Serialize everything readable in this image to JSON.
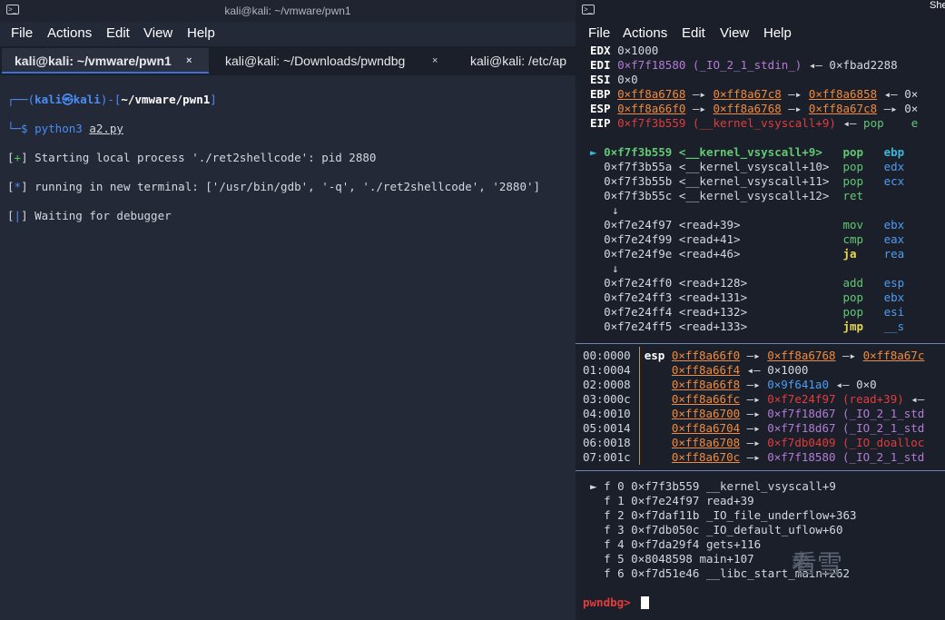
{
  "left_window": {
    "title": "kali@kali: ~/vmware/pwn1",
    "menu": [
      "File",
      "Actions",
      "Edit",
      "View",
      "Help"
    ],
    "tabs": [
      {
        "label": "kali@kali: ~/vmware/pwn1",
        "close": "×"
      },
      {
        "label": "kali@kali: ~/Downloads/pwndbg",
        "close": "×"
      },
      {
        "label": "kali@kali: /etc/ap",
        "close": ""
      }
    ],
    "prompt": {
      "open": "┌──(",
      "user": "kali㉿kali",
      "mid": ")-[",
      "path": "~/vmware/pwn1",
      "close": "]",
      "line2": "└─$ ",
      "cmd": "python3",
      "arg": "a2.py"
    },
    "output": [
      {
        "mark": "+",
        "text": "Starting local process './ret2shellcode': pid 2880"
      },
      {
        "mark": "*",
        "text": "running in new terminal: ['/usr/bin/gdb', '-q', './ret2shellcode', '2880']"
      },
      {
        "mark": "|",
        "text": "Waiting for debugger"
      }
    ]
  },
  "right_window": {
    "title": "She",
    "menu": [
      "File",
      "Actions",
      "Edit",
      "View",
      "Help"
    ],
    "registers": [
      {
        "name": "EDX",
        "parts": [
          [
            "dim",
            "0×1000"
          ]
        ]
      },
      {
        "name": "EDI",
        "parts": [
          [
            "mag",
            "0×f7f18580 (_IO_2_1_stdin_)"
          ],
          [
            "dim",
            " ◂— 0×fbad2288"
          ]
        ]
      },
      {
        "name": "ESI",
        "parts": [
          [
            "dim",
            "0×0"
          ]
        ]
      },
      {
        "name": "EBP",
        "parts": [
          [
            "orgul",
            "0×ff8a6768"
          ],
          [
            "dim",
            " —▸ "
          ],
          [
            "orgul",
            "0×ff8a67c8"
          ],
          [
            "dim",
            " —▸ "
          ],
          [
            "orgul",
            "0×ff8a6858"
          ],
          [
            "dim",
            " ◂— 0×"
          ]
        ]
      },
      {
        "name": "ESP",
        "parts": [
          [
            "orgul",
            "0×ff8a66f0"
          ],
          [
            "dim",
            " —▸ "
          ],
          [
            "orgul",
            "0×ff8a6768"
          ],
          [
            "dim",
            " —▸ "
          ],
          [
            "orgul",
            "0×ff8a67c8"
          ],
          [
            "dim",
            " —▸ 0×"
          ]
        ]
      },
      {
        "name": "EIP",
        "parts": [
          [
            "red",
            "0×f7f3b559 (__kernel_vsyscall+9)"
          ],
          [
            "dim",
            " ◂— "
          ],
          [
            "gr",
            "pop    e"
          ]
        ]
      }
    ],
    "disasm": [
      {
        "cur": true,
        "addr": "0×f7f3b559",
        "sym": "<__kernel_vsyscall+9>",
        "op": "pop",
        "arg": "ebp",
        "opc": "gr",
        "argc": "cyan"
      },
      {
        "addr": "0×f7f3b55a",
        "sym": "<__kernel_vsyscall+10>",
        "op": "pop",
        "arg": "edx",
        "opc": "gr",
        "argc": "bl2"
      },
      {
        "addr": "0×f7f3b55b",
        "sym": "<__kernel_vsyscall+11>",
        "op": "pop",
        "arg": "ecx",
        "opc": "gr",
        "argc": "bl2"
      },
      {
        "addr": "0×f7f3b55c",
        "sym": "<__kernel_vsyscall+12>",
        "op": "ret",
        "arg": "",
        "opc": "gr",
        "argc": "bl2"
      },
      {
        "arrow": "↓"
      },
      {
        "addr": "0×f7e24f97",
        "sym": "<read+39>",
        "op": "mov",
        "arg": "ebx",
        "opc": "gr",
        "argc": "bl2"
      },
      {
        "addr": "0×f7e24f99",
        "sym": "<read+41>",
        "op": "cmp",
        "arg": "eax",
        "opc": "gr",
        "argc": "bl2"
      },
      {
        "addr": "0×f7e24f9e",
        "sym": "<read+46>",
        "op": "ja",
        "arg": "rea",
        "opc": "yel",
        "argc": "bl2"
      },
      {
        "arrow": "↓"
      },
      {
        "addr": "0×f7e24ff0",
        "sym": "<read+128>",
        "op": "add",
        "arg": "esp",
        "opc": "gr",
        "argc": "bl2"
      },
      {
        "addr": "0×f7e24ff3",
        "sym": "<read+131>",
        "op": "pop",
        "arg": "ebx",
        "opc": "gr",
        "argc": "bl2"
      },
      {
        "addr": "0×f7e24ff4",
        "sym": "<read+132>",
        "op": "pop",
        "arg": "esi",
        "opc": "gr",
        "argc": "bl2"
      },
      {
        "addr": "0×f7e24ff5",
        "sym": "<read+133>",
        "op": "jmp",
        "arg": "__s",
        "opc": "yel",
        "argc": "bl2"
      }
    ],
    "stack": [
      {
        "idx": "00:0000",
        "reg": "esp",
        "parts": [
          [
            "orgul",
            "0×ff8a66f0"
          ],
          [
            "dim",
            " —▸ "
          ],
          [
            "orgul",
            "0×ff8a6768"
          ],
          [
            "dim",
            " —▸ "
          ],
          [
            "orgul",
            "0×ff8a67c"
          ]
        ]
      },
      {
        "idx": "01:0004",
        "reg": "",
        "parts": [
          [
            "orgul",
            "0×ff8a66f4"
          ],
          [
            "dim",
            " ◂— 0×1000"
          ]
        ]
      },
      {
        "idx": "02:0008",
        "reg": "",
        "parts": [
          [
            "orgul",
            "0×ff8a66f8"
          ],
          [
            "dim",
            " —▸ "
          ],
          [
            "bl2",
            "0×9f641a0"
          ],
          [
            "dim",
            " ◂— 0×0"
          ]
        ]
      },
      {
        "idx": "03:000c",
        "reg": "",
        "parts": [
          [
            "orgul",
            "0×ff8a66fc"
          ],
          [
            "dim",
            " —▸ "
          ],
          [
            "red",
            "0×f7e24f97 (read+39)"
          ],
          [
            "dim",
            " ◂—"
          ]
        ]
      },
      {
        "idx": "04:0010",
        "reg": "",
        "parts": [
          [
            "orgul",
            "0×ff8a6700"
          ],
          [
            "dim",
            " —▸ "
          ],
          [
            "mag",
            "0×f7f18d67 (_IO_2_1_std"
          ]
        ]
      },
      {
        "idx": "05:0014",
        "reg": "",
        "parts": [
          [
            "orgul",
            "0×ff8a6704"
          ],
          [
            "dim",
            " —▸ "
          ],
          [
            "mag",
            "0×f7f18d67 (_IO_2_1_std"
          ]
        ]
      },
      {
        "idx": "06:0018",
        "reg": "",
        "parts": [
          [
            "orgul",
            "0×ff8a6708"
          ],
          [
            "dim",
            " —▸ "
          ],
          [
            "red",
            "0×f7db0409 (_IO_doalloc"
          ]
        ]
      },
      {
        "idx": "07:001c",
        "reg": "",
        "parts": [
          [
            "orgul",
            "0×ff8a670c"
          ],
          [
            "dim",
            " —▸ "
          ],
          [
            "mag",
            "0×f7f18580 (_IO_2_1_std"
          ]
        ]
      }
    ],
    "backtrace": [
      {
        "mark": "►",
        "frame": "f 0",
        "addr": "0×f7f3b559",
        "sym": "__kernel_vsyscall+9"
      },
      {
        "mark": "",
        "frame": "f 1",
        "addr": "0×f7e24f97",
        "sym": "read+39"
      },
      {
        "mark": "",
        "frame": "f 2",
        "addr": "0×f7daf11b",
        "sym": "_IO_file_underflow+363"
      },
      {
        "mark": "",
        "frame": "f 3",
        "addr": "0×f7db050c",
        "sym": "_IO_default_uflow+60"
      },
      {
        "mark": "",
        "frame": "f 4",
        "addr": "0×f7da29f4",
        "sym": "gets+116"
      },
      {
        "mark": "",
        "frame": "f 5",
        "addr": "0×8048598",
        "sym": "main+107"
      },
      {
        "mark": "",
        "frame": "f 6",
        "addr": "0×f7d51e46",
        "sym": "__libc_start_main+262"
      }
    ],
    "prompt": "pwndbg>",
    "watermark": "看雪"
  },
  "colors": {
    "accent": "#3f6fd1",
    "prompt_red": "#e23c3c",
    "addr_orange": "#f08a3c"
  }
}
